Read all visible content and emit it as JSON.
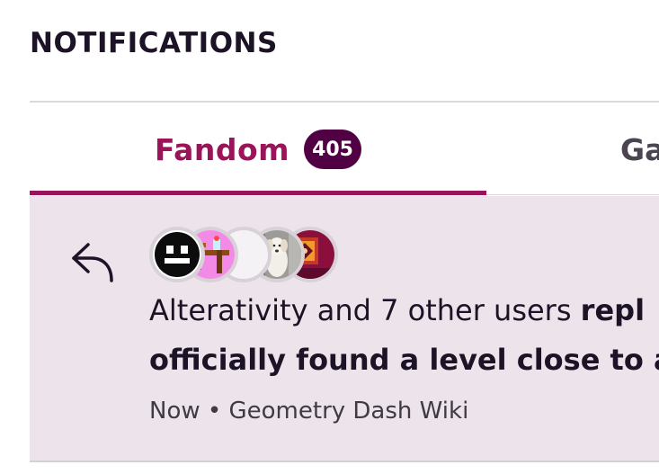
{
  "header": {
    "title": "NOTIFICATIONS"
  },
  "tabs": [
    {
      "label": "Fandom",
      "badge": "405",
      "active": true
    },
    {
      "label": "Ga",
      "active": false
    }
  ],
  "notification": {
    "icon": "reply-icon",
    "avatars": [
      {
        "name": "avatar-black-face"
      },
      {
        "name": "avatar-pink-table"
      },
      {
        "name": "avatar-blank"
      },
      {
        "name": "avatar-dog"
      },
      {
        "name": "avatar-pattern"
      }
    ],
    "text_line1_regular": "Alterativity and 7 other users ",
    "text_line1_bold": "repl",
    "text_line2_bold": "officially found a level close to as",
    "time": "Now",
    "separator": "•",
    "wiki": "Geometry Dash Wiki"
  },
  "colors": {
    "accent": "#9b1358",
    "badge": "#520044",
    "notification_bg": "#ece4ea",
    "text": "#1d1327"
  }
}
